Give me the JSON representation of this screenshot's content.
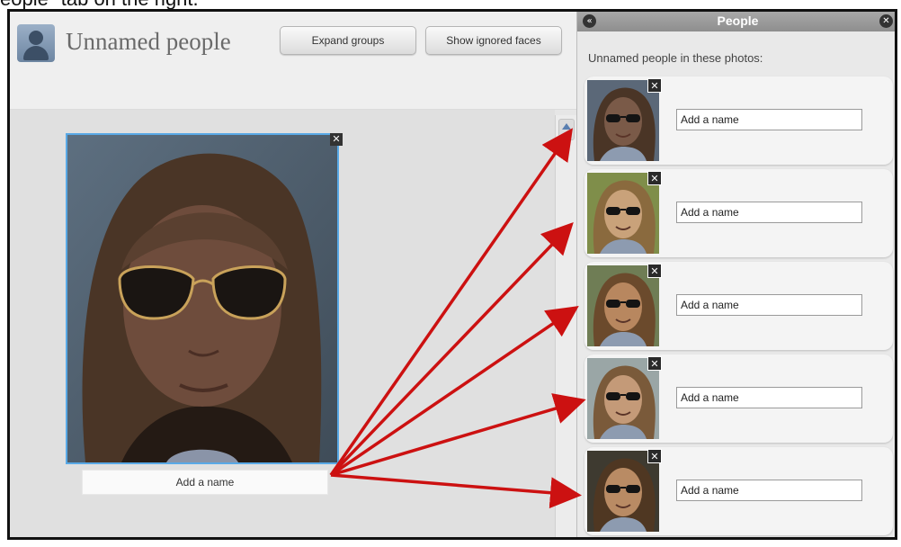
{
  "caption": "eople\" tab on the right.",
  "header": {
    "title": "Unnamed people",
    "expand_label": "Expand groups",
    "ignored_label": "Show ignored faces"
  },
  "main_face": {
    "name_label": "Add a name",
    "close_glyph": "✕"
  },
  "panel": {
    "title": "People",
    "collapse_glyph": "«",
    "close_glyph": "✕",
    "subtitle": "Unnamed people in these photos:",
    "thumb_close_glyph": "✕",
    "cards": [
      {
        "placeholder": "Add a name",
        "skin": "#7a5a48",
        "hair": "#4a3526",
        "bg": "#5b6878"
      },
      {
        "placeholder": "Add a name",
        "skin": "#c9a27a",
        "hair": "#8a6a3e",
        "bg": "#7f8e4a"
      },
      {
        "placeholder": "Add a name",
        "skin": "#b8875f",
        "hair": "#6b4a2c",
        "bg": "#6f7d55"
      },
      {
        "placeholder": "Add a name",
        "skin": "#c49a78",
        "hair": "#7a5a3a",
        "bg": "#9aa6a6"
      },
      {
        "placeholder": "Add a name",
        "skin": "#b98b64",
        "hair": "#4f3722",
        "bg": "#3e3a30"
      }
    ]
  },
  "colors": {
    "selection_border": "#59a9e6",
    "arrow": "#cc1111"
  }
}
